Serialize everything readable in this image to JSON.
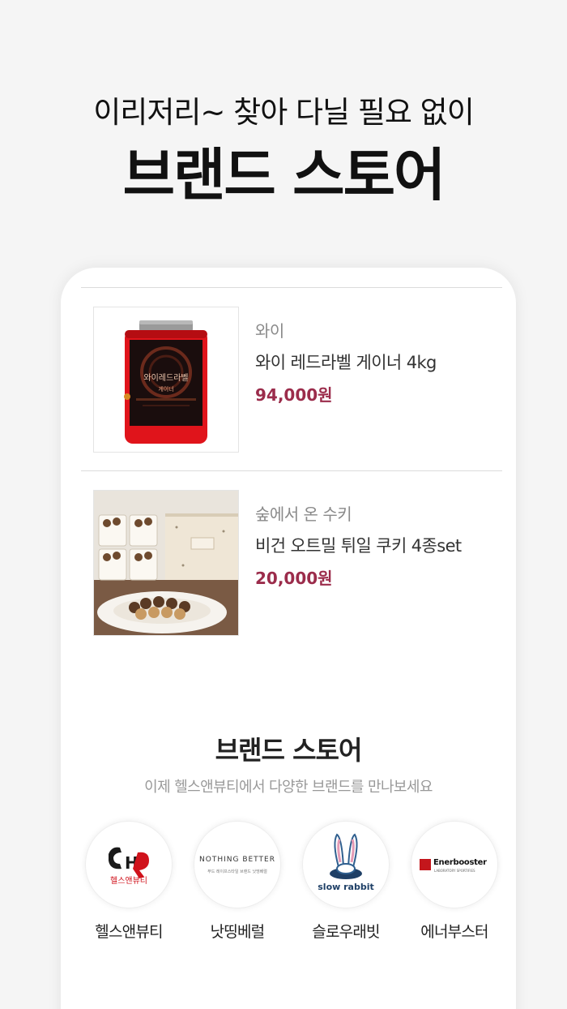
{
  "hero": {
    "subtitle": "이리저리~ 찾아 다닐 필요 없이",
    "title": "브랜드 스토어"
  },
  "products": [
    {
      "brand": "와이",
      "name": "와이 레드라벨 게이너 4kg",
      "price": "94,000원",
      "image_label": "와이레드라벨",
      "image_sublabel": "게이너"
    },
    {
      "brand": "숲에서 온 수키",
      "name": "비건 오트밀 튀일 쿠키 4종set",
      "price": "20,000원"
    }
  ],
  "brand_section": {
    "title": "브랜드 스토어",
    "description": "이제 헬스앤뷰티에서 다양한 브랜드를 만나보세요"
  },
  "brands": [
    {
      "name": "헬스앤뷰티",
      "logo_text": "헬스앤뷰티"
    },
    {
      "name": "낫띵베럴",
      "logo_text": "NOTHING BETTER",
      "logo_subtext": "푸드 레이프스타일 브랜드 낫띵베럴"
    },
    {
      "name": "슬로우래빗",
      "logo_text": "slow rabbit"
    },
    {
      "name": "에너부스터",
      "logo_text": "Enerbooster",
      "logo_subtext": "LABORATORY SPORTIFIES"
    }
  ],
  "colors": {
    "price": "#9b2c4b",
    "background": "#f5f5f5",
    "enerbooster_red": "#c4161c"
  }
}
